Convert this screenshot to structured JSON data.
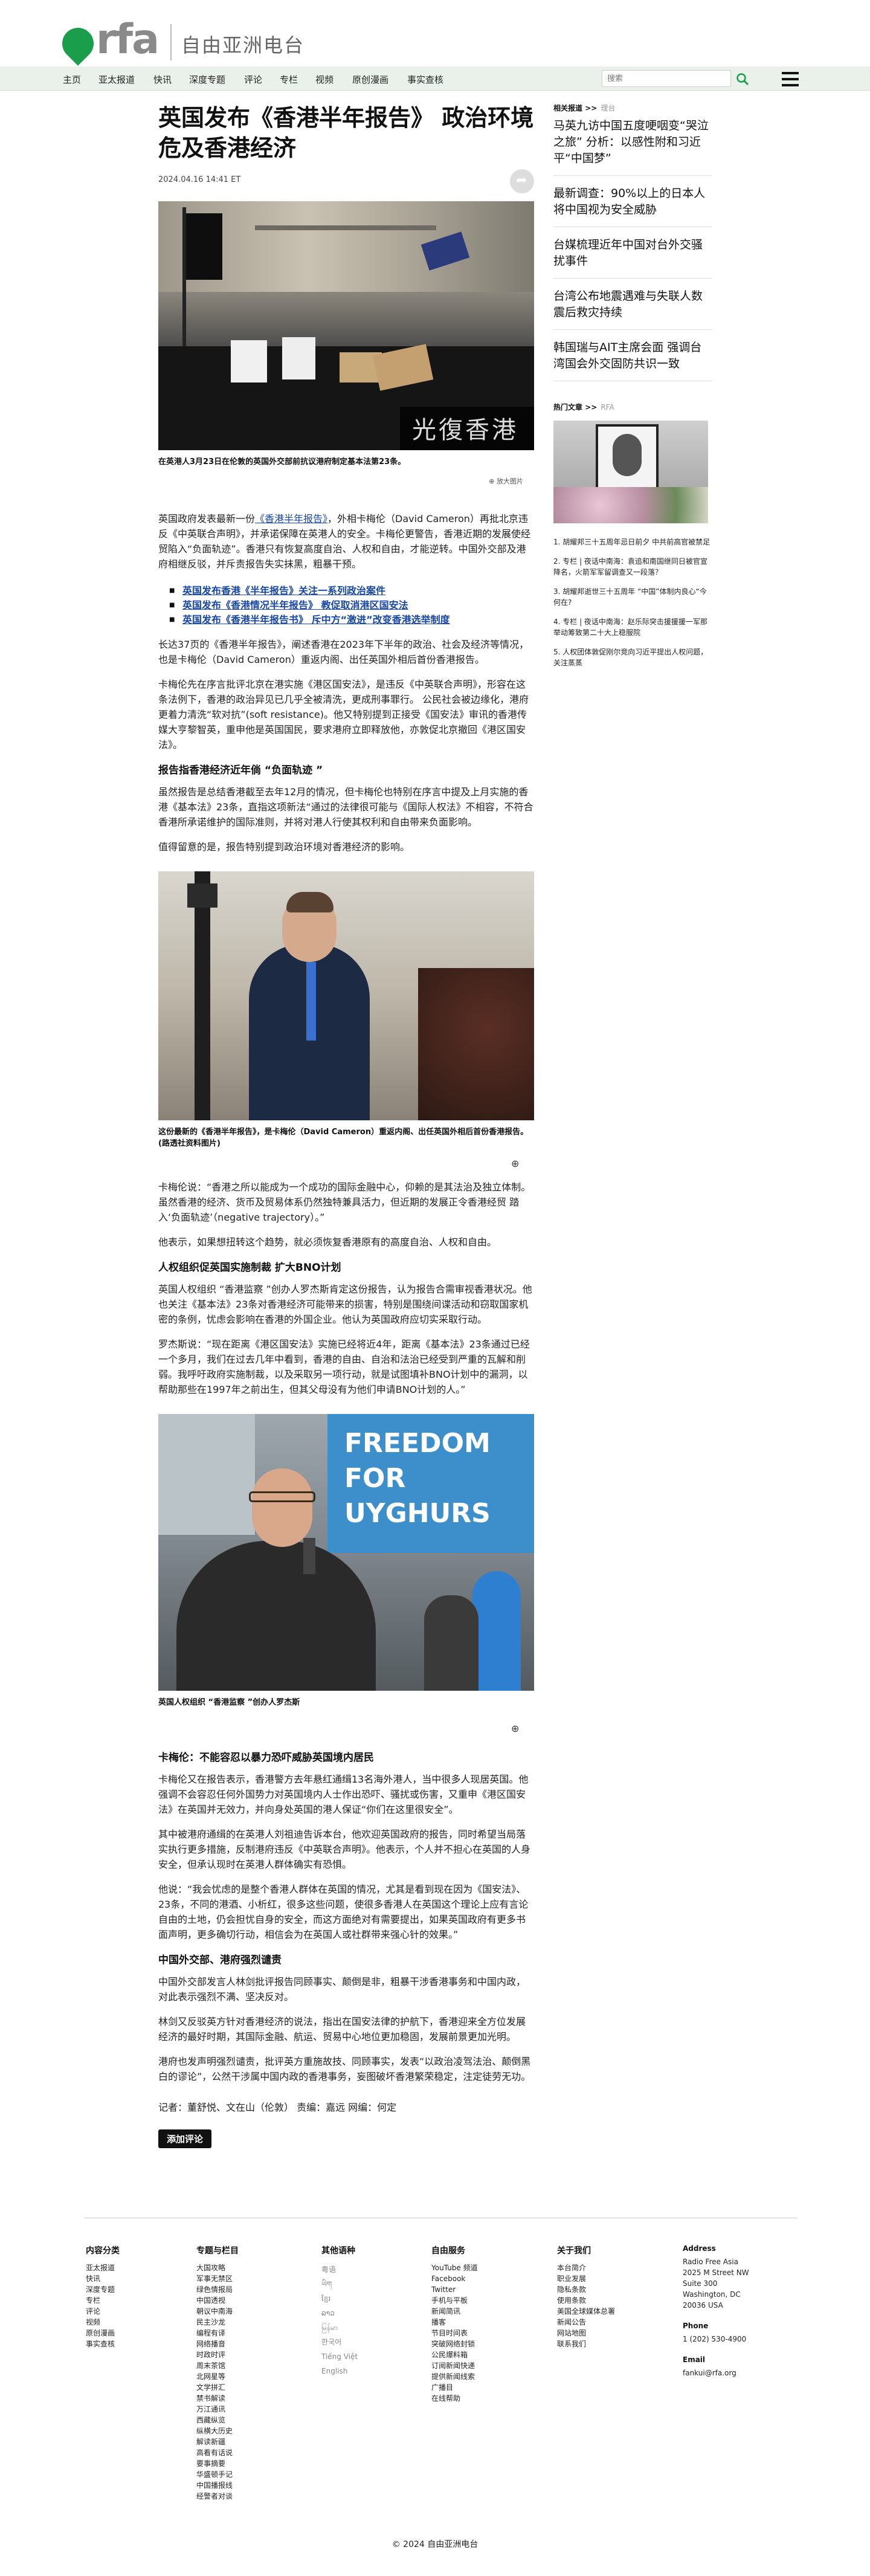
{
  "site": {
    "logo_text": "rfa",
    "title": "自由亚洲电台"
  },
  "nav": {
    "items": [
      "主页",
      "亚太报道",
      "快讯",
      "深度专题",
      "评论",
      "专栏",
      "视频",
      "原创漫画",
      "事实查核"
    ],
    "search_placeholder": "搜索"
  },
  "article": {
    "title": "英国发布《香港半年报告》 政治环境危及香港经济",
    "date": "2024.04.16 14:41 ET",
    "photo1_caption": "在英港人3月23日在伦敦的英国外交部前抗议港府制定基本法第23条。",
    "enlarge_text": "⊕ 放大图片",
    "p1_a": "英国政府发表最新一份",
    "p1_link": "《香港半年报告》",
    "p1_b": "，外相卡梅伦（David Cameron）再批北京违反《中英联合声明》，并承诺保障在英港人的安全。卡梅伦更警告，香港近期的发展使经贸陷入“负面轨迹”。香港只有恢复高度自治、人权和自由，才能逆转。中国外交部及港府相继反驳，并斥责报告失实抹黑，粗暴干预。",
    "related": [
      "英国发布香港《半年报告》关注一系列政治案件",
      "英国发布《香港情况半年报告》 教促取消港区国安法",
      "英国发布《香港半年报告书》 斥中方“激进”改变香港选举制度"
    ],
    "p2": "长达37页的《香港半年报告》，阐述香港在2023年下半年的政治、社会及经济等情况，也是卡梅伦（David Cameron）重返内阁、出任英国外相后首份香港报告。",
    "p3": "卡梅伦先在序言批评北京在港实施《港区国安法》，是违反《中英联合声明》，形容在这条法例下，香港的政治异见已几乎全被清洗，更成刑事罪行。 公民社会被边缘化，港府更着力清洗“软对抗”(soft resistance)。他又特别提到正接受《国安法》审讯的香港传媒大亨黎智英，重申他是英国国民，要求港府立即释放他，亦敦促北京撤回《港区国安法》。",
    "h1": "报告指香港经济近年倘 “负面轨迹 ”",
    "p4": "虽然报告是总结香港截至去年12月的情况，但卡梅伦也特别在序言中提及上月实施的香港《基本法》23条，直指这项新法“通过的法律很可能与《国际人权法》不相容，不符合香港所承诺维护的国际准则，并将对港人行使其权利和自由带来负面影响。",
    "p5": "值得留意的是，报告特别提到政治环境对香港经济的影响。",
    "photo2_caption": "这份最新的《香港半年报告》，是卡梅伦（David Cameron）重返内阁、出任英国外相后首份香港报告。(路透社资料图片)",
    "p6": "卡梅伦说：“香港之所以能成为一个成功的国际金融中心，仰赖的是其法治及独立体制。虽然香港的经济、货币及贸易体系仍然独特兼具活力，但近期的发展正令香港经贸 踏入‘负面轨迹’（negative trajectory）。”",
    "p7": "他表示，如果想扭转这个趋势，就必须恢复香港原有的高度自治、人权和自由。",
    "h2": "人权组织促英国实施制裁   扩大BNO计划",
    "p8": "英国人权组织 “香港监察 ”创办人罗杰斯肯定这份报告，认为报告合需审视香港状况。他也关注《基本法》23条对香港经济可能带来的损害，特别是围绕间谍活动和窃取国家机密的条例，忧虑会影响在香港的外国企业。他认为英国政府应切实采取行动。",
    "p9": "罗杰斯说：“现在距离《港区国安法》实施已经将近4年，距离《基本法》23条通过已经一个多月，我们在过去几年中看到，香港的自由、自治和法治已经受到严重的瓦解和削弱。我呼吁政府实施制裁，以及采取另一项行动，就是试图填补BNO计划中的漏洞，以帮助那些在1997年之前出生，但其父母没有为他们申请BNO计划的人。”",
    "photo3_caption": "英国人权组织 “香港监察 ”创办人罗杰斯",
    "photo3_banner": "FREEDOM FOR UYGHURS",
    "h3": "卡梅伦：不能容忍以暴力恐吓威胁英国境内居民",
    "p10": "卡梅伦又在报告表示，香港警方去年悬红通缉13名海外港人，当中很多人现居英国。他强调不会容忍任何外国势力对英国境内人士作出恐吓、骚扰或伤害，又重申《港区国安法》在英国并无效力，并向身处英国的港人保证“你们在这里很安全”。",
    "p11": "其中被港府通缉的在英港人刘祖迪告诉本台，他欢迎英国政府的报告，同时希望当局落实执行更多措施，反制港府违反《中英联合声明》。他表示，个人并不担心在英国的人身安全，但承认现时在英港人群体确实有恐惧。",
    "p12": "他说：“我会忧虑的是整个香港人群体在英国的情况，尤其是看到现在因为《国安法》、23条，不同的港酒、小析红，很多这些问题，使很多香港人在英国这个理论上应有言论自由的土地，仍会担忧自身的安全，而这方面绝对有需要提出，如果英国政府有更多书面声明，更多确切行动，相信会为在英国人或社群带来强心针的效果。”",
    "h4": "中国外交部、港府强烈谴责",
    "p13": "中国外交部发言人林剑批评报告同顾事实、颠倒是非，粗暴干涉香港事务和中国内政，对此表示强烈不满、坚决反对。",
    "p14": "林剑又反驳英方针对香港经济的说法，指出在国安法律的护航下，香港迎来全方位发展经济的最好时期，其国际金融、航运、贸易中心地位更加稳固，发展前景更加光明。",
    "p15": "港府也发声明强烈谴责，批评英方重施故技、同顾事实，发表“以政治凌驾法治、颠倒黑白的谬论”，公然干涉属中国内政的香港事务，妄图破坏香港繁荣稳定，注定徒劳无功。",
    "credits": "记者：董舒悦、文在山（伦敦）   责编：嘉远   网编：何定",
    "comment_label": "添加评论"
  },
  "sidebar": {
    "related_label": "相关报道",
    "related_more": "理台",
    "related": [
      "马英九访中国五度哽咽变“哭泣之旅” 分析：以感性附和习近平“中国梦”",
      "最新调查：90%以上的日本人将中国视为安全威胁",
      "台媒梳理近年中国对台外交骚扰事件",
      "台湾公布地震遇难与失联人数 震后救灾持续",
      "韩国瑞与AIT主席会面 强调台湾国会外交固防共识一致"
    ],
    "popular_label": "热门文章",
    "popular_more": "RFA",
    "popular": [
      "1. 胡耀邦三十五周年忌日前夕 中共前高官被禁足",
      "2. 专栏 | 夜话中南海：袁追和南国继同日被官宣降名，火箭军军留调查又一段落？",
      "3. 胡耀邦逝世三十五周年 “中国”体制内良心“今何在?",
      "4. 专栏 | 夜话中南海：赵乐际突击援援援一军那举动筹致第二十大上稳服院",
      "5. 人权团体敦促刚尔竞向习近平提出人权问题，关注蒸蒸"
    ]
  },
  "footer": {
    "columns": [
      {
        "heading": "内容分类",
        "items": [
          "亚太报道",
          "快讯",
          "深度专题",
          "专栏",
          "评论",
          "视频",
          "原创漫画",
          "事实查核"
        ]
      },
      {
        "heading": "专题与栏目",
        "items": [
          "大国攻略",
          "军事无禁区",
          "绿色情报局",
          "中国透视",
          "朝议中南海",
          "民主沙龙",
          "编程有译",
          "网络播音",
          "时政时评",
          "周末茶馆",
          "北网星等",
          "文学拼汇",
          "禁书解读",
          "万江通讯",
          "西藏纵览",
          "纵横大历史",
          "解读新疆",
          "高看有话说",
          "要事摘要",
          "华盛顿手记",
          "中国播报线",
          "经警者对谈"
        ]
      },
      {
        "heading": "其他语种",
        "items": [
          "粤语",
          "ཡིག",
          "ខ្មែរ",
          "ລາວ",
          "မြန်မာ",
          "한국어",
          "Tiếng Việt",
          "English"
        ]
      },
      {
        "heading": "自由服务",
        "items": [
          "YouTube 频道",
          "Facebook",
          "Twitter",
          "手机与平板",
          "新闻简讯",
          "播客",
          "节目时间表",
          "突破网络封锁",
          "公民爆料箱",
          "订阅新闻快递",
          "提供新闻线索",
          "广播目",
          "在线帮助"
        ]
      },
      {
        "heading": "关于我们",
        "items": [
          "本台简介",
          "职业发展",
          "隐私条款",
          "使用条款",
          "美国全球媒体总署",
          "新闻公告",
          "网站地图",
          "联系我们"
        ]
      }
    ],
    "address_heading": "Address",
    "address_lines": [
      "Radio Free Asia",
      "2025 M Street NW",
      "Suite 300",
      "Washington, DC",
      "20036 USA"
    ],
    "phone_heading": "Phone",
    "phone": "1 (202) 530-4900",
    "email_heading": "Email",
    "email": "fankui@rfa.org",
    "copyright": "© 2024 自由亚洲电台"
  },
  "colors": {
    "brand_green": "#1b9e4c",
    "nav_bg": "#e9f1ea",
    "link_blue": "#1646a8"
  }
}
